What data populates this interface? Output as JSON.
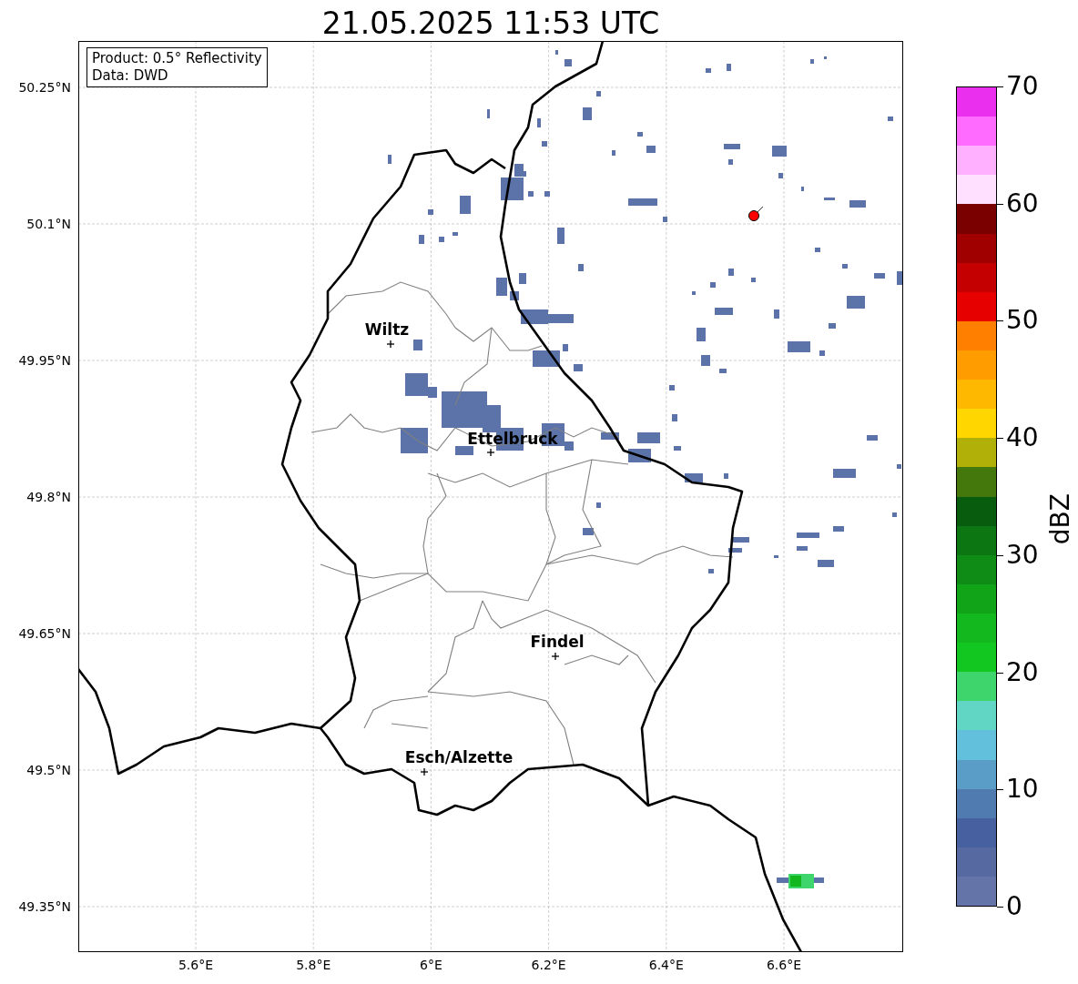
{
  "title": "21.05.2025 11:53 UTC",
  "legend": [
    "Product: 0.5° Reflectivity",
    "Data: DWD"
  ],
  "lat_ticks": [
    "50.25°N",
    "50.1°N",
    "49.95°N",
    "49.8°N",
    "49.65°N",
    "49.5°N",
    "49.35°N"
  ],
  "lon_ticks": [
    "5.6°E",
    "5.8°E",
    "6°E",
    "6.2°E",
    "6.4°E",
    "6.6°E"
  ],
  "cities": [
    {
      "name": "Wiltz"
    },
    {
      "name": "Ettelbruck"
    },
    {
      "name": "Findel"
    },
    {
      "name": "Esch/Alzette"
    }
  ],
  "colorbar": {
    "label": "dBZ",
    "ticks": [
      "70",
      "60",
      "50",
      "40",
      "30",
      "20",
      "10",
      "0"
    ],
    "bands": [
      {
        "color": "#ea30ee"
      },
      {
        "color": "#ff6aff"
      },
      {
        "color": "#ffb0ff"
      },
      {
        "color": "#ffe0ff"
      },
      {
        "color": "#7a0000"
      },
      {
        "color": "#a00000"
      },
      {
        "color": "#c40000"
      },
      {
        "color": "#e60000"
      },
      {
        "color": "#ff7f00"
      },
      {
        "color": "#ff9c00"
      },
      {
        "color": "#ffb800"
      },
      {
        "color": "#ffd600"
      },
      {
        "color": "#b0b008"
      },
      {
        "color": "#44780c"
      },
      {
        "color": "#075c0d"
      },
      {
        "color": "#0c7612"
      },
      {
        "color": "#0f8c15"
      },
      {
        "color": "#12a418"
      },
      {
        "color": "#12b81d"
      },
      {
        "color": "#12c820"
      },
      {
        "color": "#3fd56d"
      },
      {
        "color": "#62d6c4"
      },
      {
        "color": "#62c0dc"
      },
      {
        "color": "#5a9ec8"
      },
      {
        "color": "#4f7bb0"
      },
      {
        "color": "#4760a0"
      },
      {
        "color": "#5669a1"
      },
      {
        "color": "#6474a8"
      }
    ]
  }
}
